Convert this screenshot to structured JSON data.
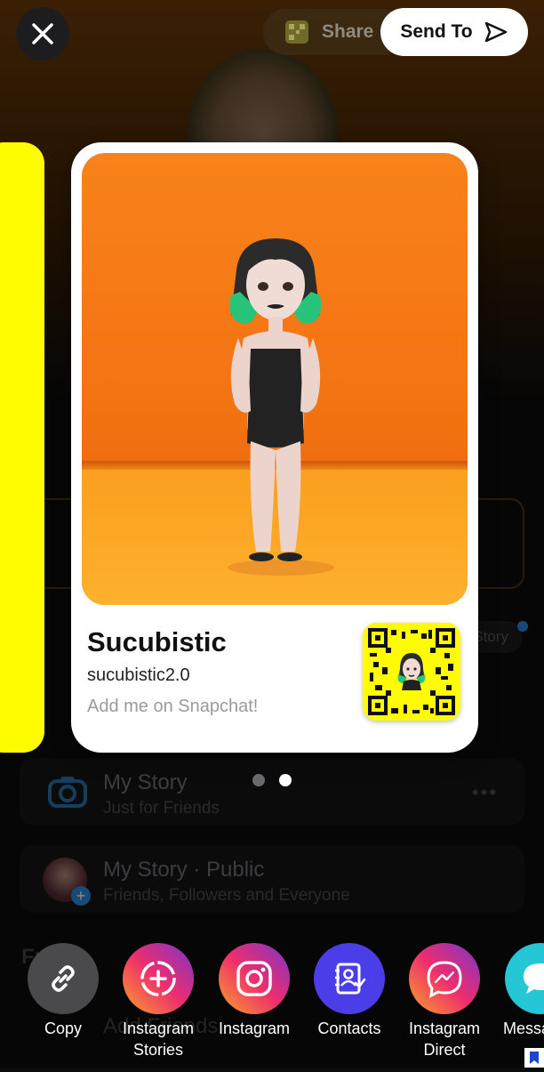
{
  "header": {
    "share_label": "Share",
    "send_label": "Send To"
  },
  "card": {
    "display_name": "Sucubistic",
    "username": "sucubistic2.0",
    "tagline": "Add me on Snapchat!"
  },
  "pager": {
    "count": 2,
    "active_index": 1
  },
  "background": {
    "my_story": {
      "title": "My Story",
      "subtitle": "Just for Friends"
    },
    "public_story": {
      "title": "My Story · Public",
      "subtitle": "Friends, Followers and Everyone"
    },
    "story_pill": "Story",
    "friends_heading": "Fr",
    "add_friends": "Add Friends",
    "more_glyph": "•••"
  },
  "share_targets": [
    {
      "label": "Copy",
      "label2": "",
      "icon": "link-icon"
    },
    {
      "label": "Instagram",
      "label2": "Stories",
      "icon": "instagram-stories-icon"
    },
    {
      "label": "Instagram",
      "label2": "",
      "icon": "instagram-icon"
    },
    {
      "label": "Contacts",
      "label2": "",
      "icon": "contacts-icon"
    },
    {
      "label": "Instagram",
      "label2": "Direct",
      "icon": "messenger-icon"
    },
    {
      "label": "Messa",
      "label2": "",
      "icon": "messages-icon"
    }
  ],
  "colors": {
    "snap_yellow": "#fffc00",
    "orange_backdrop": "#f27212",
    "contacts_purple": "#4b3de8"
  }
}
